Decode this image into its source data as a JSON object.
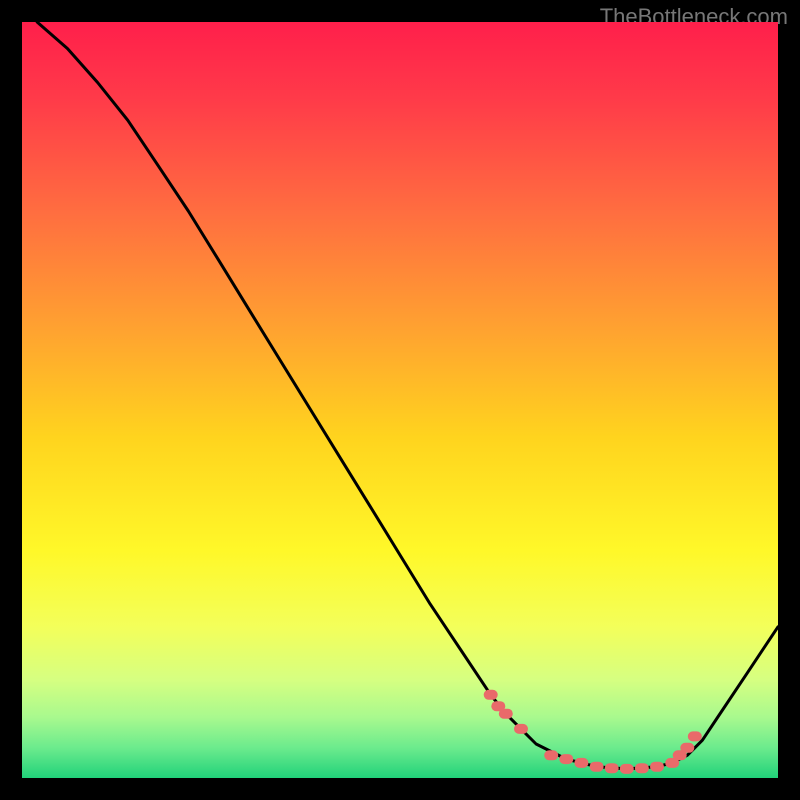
{
  "watermark": "TheBottleneck.com",
  "chart_data": {
    "type": "line",
    "title": "",
    "xlabel": "",
    "ylabel": "",
    "xlim": [
      0,
      100
    ],
    "ylim": [
      0,
      100
    ],
    "series": [
      {
        "name": "curve",
        "x": [
          2,
          6,
          10,
          14,
          18,
          22,
          26,
          30,
          34,
          38,
          42,
          46,
          50,
          54,
          58,
          62,
          64,
          66,
          68,
          72,
          76,
          80,
          84,
          86,
          88,
          90,
          92,
          96,
          100
        ],
        "y": [
          100,
          96.5,
          92,
          87,
          81,
          75,
          68.5,
          62,
          55.5,
          49,
          42.5,
          36,
          29.5,
          23,
          17,
          11,
          8.5,
          6.5,
          4.5,
          2.5,
          1.5,
          1.2,
          1.5,
          2.0,
          3.0,
          5.0,
          8.0,
          14.0,
          20.0
        ]
      }
    ],
    "markers": {
      "name": "dotted-segment",
      "points": [
        {
          "x": 62,
          "y": 11
        },
        {
          "x": 63,
          "y": 9.5
        },
        {
          "x": 64,
          "y": 8.5
        },
        {
          "x": 66,
          "y": 6.5
        },
        {
          "x": 70,
          "y": 3.0
        },
        {
          "x": 72,
          "y": 2.5
        },
        {
          "x": 74,
          "y": 2.0
        },
        {
          "x": 76,
          "y": 1.5
        },
        {
          "x": 78,
          "y": 1.3
        },
        {
          "x": 80,
          "y": 1.2
        },
        {
          "x": 82,
          "y": 1.3
        },
        {
          "x": 84,
          "y": 1.5
        },
        {
          "x": 86,
          "y": 2.0
        },
        {
          "x": 87,
          "y": 3.0
        },
        {
          "x": 88,
          "y": 4.0
        },
        {
          "x": 89,
          "y": 5.5
        }
      ]
    },
    "gradient_stops": [
      {
        "offset": 0.0,
        "color": "#ff1f4b"
      },
      {
        "offset": 0.1,
        "color": "#ff3a49"
      },
      {
        "offset": 0.25,
        "color": "#ff6d40"
      },
      {
        "offset": 0.4,
        "color": "#ffa031"
      },
      {
        "offset": 0.55,
        "color": "#ffd41e"
      },
      {
        "offset": 0.7,
        "color": "#fff829"
      },
      {
        "offset": 0.8,
        "color": "#f3ff5a"
      },
      {
        "offset": 0.87,
        "color": "#d6ff81"
      },
      {
        "offset": 0.92,
        "color": "#a8f98e"
      },
      {
        "offset": 0.96,
        "color": "#6ceb8d"
      },
      {
        "offset": 1.0,
        "color": "#21d27a"
      }
    ]
  }
}
